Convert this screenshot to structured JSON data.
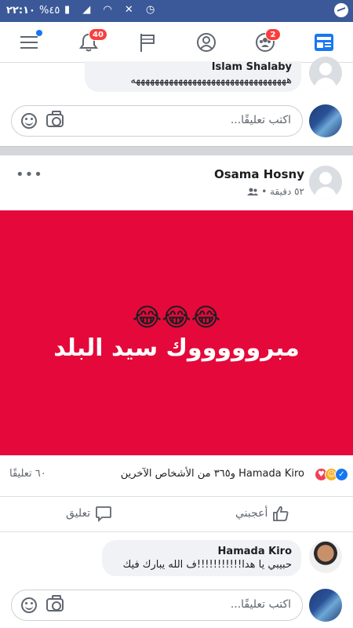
{
  "status_bar": {
    "time": "٢٢:١٠",
    "battery": "%٤٥"
  },
  "nav": {
    "notifications_badge": "40",
    "friends_badge": "2"
  },
  "top_comment": {
    "author": "Islam Shalaby",
    "text": "هههههههههههههههههههههههههههههههههه"
  },
  "comment_input": {
    "placeholder": "اكتب تعليقًا..."
  },
  "post": {
    "author": "Osama Hosny",
    "time": "٥٢ دقيقة •",
    "emojis": "😂😂😂",
    "caption": "مبروووووك سيد البلد",
    "reactions_name": "Hamada Kiro",
    "reactions_others": "و٣٦٥ من الأشخاص الآخرين",
    "comments_count": "٦٠ تعليقًا",
    "like_label": "أعجبني",
    "comment_label": "تعليق"
  },
  "reply": {
    "author": "Hamada Kiro",
    "text": "حبيبي يا هدا!!!!!!!!!!!ف الله يبارك فيك"
  },
  "colors": {
    "brand": "#3b5998",
    "image_bg": "#e4093a",
    "badge": "#fa3e3e",
    "accent": "#1877f2"
  }
}
